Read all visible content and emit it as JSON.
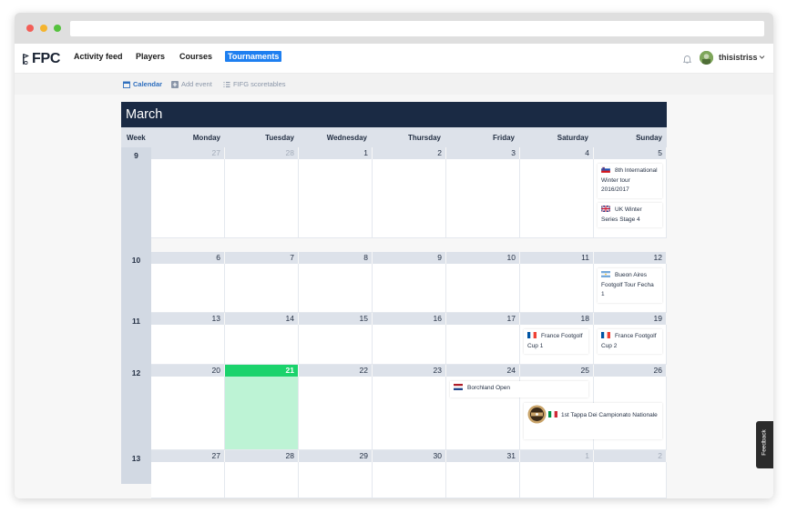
{
  "nav": {
    "logo": "FPC",
    "items": [
      {
        "label": "Activity feed",
        "active": false
      },
      {
        "label": "Players",
        "active": false
      },
      {
        "label": "Courses",
        "active": false
      },
      {
        "label": "Tournaments",
        "active": true
      }
    ],
    "username": "thisistriss"
  },
  "subnav": {
    "calendar": "Calendar",
    "add_event": "Add event",
    "scoretables": "FIFG scoretables"
  },
  "calendar": {
    "month": "March",
    "week_header": "Week",
    "days": [
      "Monday",
      "Tuesday",
      "Wednesday",
      "Thursday",
      "Friday",
      "Saturday",
      "Sunday"
    ],
    "weeks": [
      {
        "number": "9",
        "dates": [
          "27",
          "28",
          "1",
          "2",
          "3",
          "4",
          "5"
        ],
        "dim": [
          true,
          true,
          false,
          false,
          false,
          false,
          false
        ]
      },
      {
        "number": "10",
        "dates": [
          "6",
          "7",
          "8",
          "9",
          "10",
          "11",
          "12"
        ],
        "dim": [
          false,
          false,
          false,
          false,
          false,
          false,
          false
        ]
      },
      {
        "number": "11",
        "dates": [
          "13",
          "14",
          "15",
          "16",
          "17",
          "18",
          "19"
        ],
        "dim": [
          false,
          false,
          false,
          false,
          false,
          false,
          false
        ]
      },
      {
        "number": "12",
        "dates": [
          "20",
          "21",
          "22",
          "23",
          "24",
          "25",
          "26"
        ],
        "dim": [
          false,
          false,
          false,
          false,
          false,
          false,
          false
        ]
      },
      {
        "number": "13",
        "dates": [
          "27",
          "28",
          "29",
          "30",
          "31",
          "1",
          "2"
        ],
        "dim": [
          false,
          false,
          false,
          false,
          false,
          true,
          true
        ]
      }
    ],
    "today": "21",
    "events": [
      {
        "title": "8th International Winter tour 2016/2017",
        "flag": "slovenia-flag"
      },
      {
        "title": "UK Winter Series Stage 4",
        "flag": "uk-flag"
      },
      {
        "title": "Bueon Aires Footgolf Tour Fecha 1",
        "flag": "argentina-flag"
      },
      {
        "title": "France Footgolf Cup 1",
        "flag": "france-flag"
      },
      {
        "title": "France Footgolf Cup 2",
        "flag": "france-flag"
      },
      {
        "title": "Borchland Open",
        "flag": "netherlands-flag"
      },
      {
        "title": "1st Tappa Dei Campionato Nationale",
        "flag": "italy-flag"
      }
    ]
  },
  "feedback": "Feedback",
  "colors": {
    "accent": "#1e7ff0",
    "header": "#1a2a44",
    "today": "#1bd36c",
    "today_fill": "#bdf3d5"
  }
}
